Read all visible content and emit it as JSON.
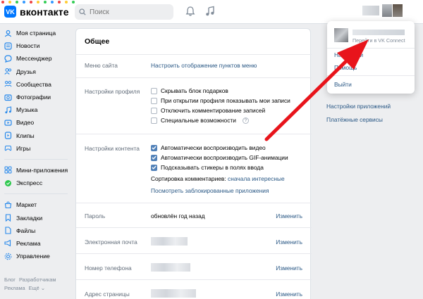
{
  "header": {
    "logo_text": "вконтакте",
    "logo_mark": "VK",
    "search_placeholder": "Поиск"
  },
  "sidebar": {
    "items": [
      {
        "label": "Моя страница",
        "icon": "user-icon"
      },
      {
        "label": "Новости",
        "icon": "news-icon"
      },
      {
        "label": "Мессенджер",
        "icon": "chat-icon"
      },
      {
        "label": "Друзья",
        "icon": "friends-icon"
      },
      {
        "label": "Сообщества",
        "icon": "groups-icon"
      },
      {
        "label": "Фотографии",
        "icon": "photo-icon"
      },
      {
        "label": "Музыка",
        "icon": "music-icon"
      },
      {
        "label": "Видео",
        "icon": "video-icon"
      },
      {
        "label": "Клипы",
        "icon": "clips-icon"
      },
      {
        "label": "Игры",
        "icon": "games-icon"
      }
    ],
    "items2": [
      {
        "label": "Мини-приложения",
        "icon": "apps-icon"
      },
      {
        "label": "Экспресс",
        "icon": "express-icon"
      }
    ],
    "items3": [
      {
        "label": "Маркет",
        "icon": "market-icon"
      },
      {
        "label": "Закладки",
        "icon": "bookmark-icon"
      },
      {
        "label": "Файлы",
        "icon": "files-icon"
      },
      {
        "label": "Реклама",
        "icon": "ads-icon"
      },
      {
        "label": "Управление",
        "icon": "manage-icon"
      }
    ],
    "footer": {
      "blog": "Блог",
      "developers": "Разработчикам",
      "ads": "Реклама",
      "more": "Ещё ⌄"
    }
  },
  "settings": {
    "title": "Общее",
    "site_menu": {
      "label": "Меню сайта",
      "link": "Настроить отображение пунктов меню"
    },
    "profile": {
      "label": "Настройки профиля",
      "options": [
        {
          "text": "Скрывать блок подарков",
          "checked": false
        },
        {
          "text": "При открытии профиля показывать мои записи",
          "checked": false
        },
        {
          "text": "Отключить комментирование записей",
          "checked": false
        },
        {
          "text": "Специальные возможности",
          "checked": false
        }
      ]
    },
    "content": {
      "label": "Настройки контента",
      "options": [
        {
          "text": "Автоматически воспроизводить видео",
          "checked": true
        },
        {
          "text": "Автоматически воспроизводить GIF-анимации",
          "checked": true
        },
        {
          "text": "Подсказывать стикеры в полях ввода",
          "checked": true
        }
      ],
      "sort_label": "Сортировка комментариев:",
      "sort_value": "сначала интересные",
      "blocked_apps": "Посмотреть заблокированные приложения"
    },
    "password": {
      "label": "Пароль",
      "value": "обновлён год назад",
      "action": "Изменить"
    },
    "email": {
      "label": "Электронная почта",
      "action": "Изменить"
    },
    "phone": {
      "label": "Номер телефона",
      "action": "Изменить"
    },
    "address": {
      "label": "Адрес страницы",
      "action": "Изменить"
    }
  },
  "right_menu": {
    "app_settings": "Настройки приложений",
    "payments": "Платёжные сервисы"
  },
  "account_dropdown": {
    "connect": "Перейти в VK Connect",
    "settings": "Настройки",
    "help": "Помощь",
    "logout": "Выйти"
  },
  "colors": {
    "accent": "#0077ff",
    "link": "#2a5885",
    "checkbox": "#5181b8",
    "annotation_arrow": "#e8141b"
  }
}
